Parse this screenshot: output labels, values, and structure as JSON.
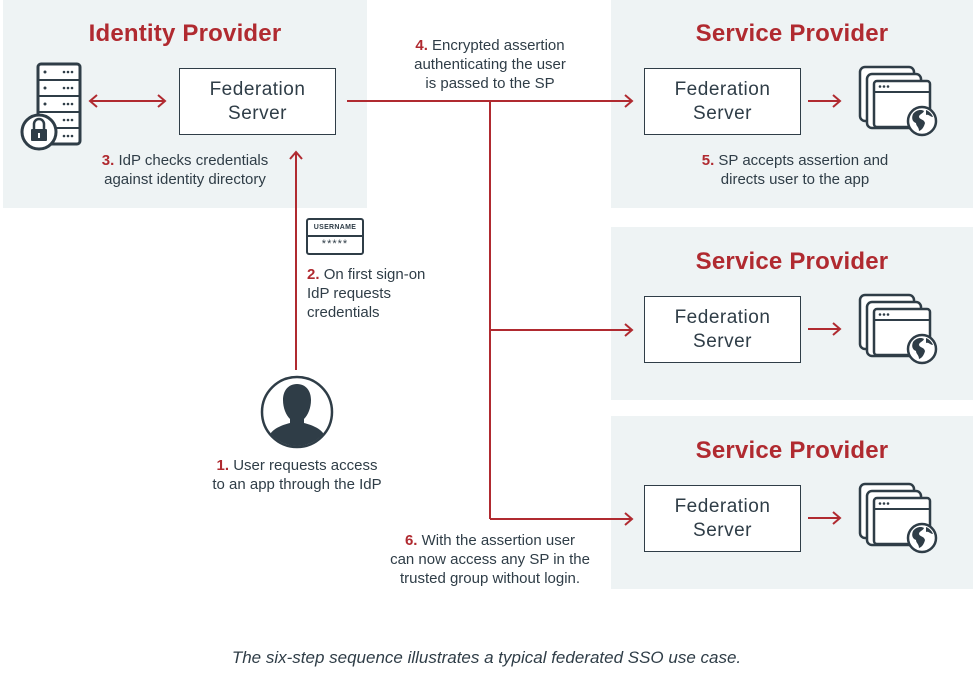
{
  "colors": {
    "accent": "#b02a30",
    "text": "#2f3d47",
    "panel_bg": "#eef3f4"
  },
  "identity_provider": {
    "title": "Identity Provider",
    "server_label_line1": "Federation",
    "server_label_line2": "Server",
    "directory_icon": "server-lock-icon",
    "step3": {
      "num": "3.",
      "line1": "IdP checks credentials",
      "line2": "against identity directory"
    }
  },
  "service_providers": [
    {
      "title": "Service Provider",
      "server_label_line1": "Federation",
      "server_label_line2": "Server",
      "app_icon": "web-apps-globe-icon"
    },
    {
      "title": "Service Provider",
      "server_label_line1": "Federation",
      "server_label_line2": "Server",
      "app_icon": "web-apps-globe-icon"
    },
    {
      "title": "Service Provider",
      "server_label_line1": "Federation",
      "server_label_line2": "Server",
      "app_icon": "web-apps-globe-icon"
    }
  ],
  "steps": {
    "step1": {
      "num": "1.",
      "line1": "User requests access",
      "line2": "to an app through the IdP"
    },
    "step2": {
      "num": "2.",
      "line1": "On first sign-on",
      "line2": "IdP requests",
      "line3": "credentials"
    },
    "step4": {
      "num": "4.",
      "line1": "Encrypted assertion",
      "line2": "authenticating the user",
      "line3": "is passed to the SP"
    },
    "step5": {
      "num": "5.",
      "line1": "SP accepts assertion and",
      "line2": "directs user to the app"
    },
    "step6": {
      "num": "6.",
      "line1": "With the assertion user",
      "line2": "can now access any SP in the",
      "line3": "trusted group without login."
    }
  },
  "credentials_card": {
    "username_label": "USERNAME",
    "password_mask": "*****"
  },
  "footnote": "The six-step sequence illustrates a typical federated SSO use case."
}
